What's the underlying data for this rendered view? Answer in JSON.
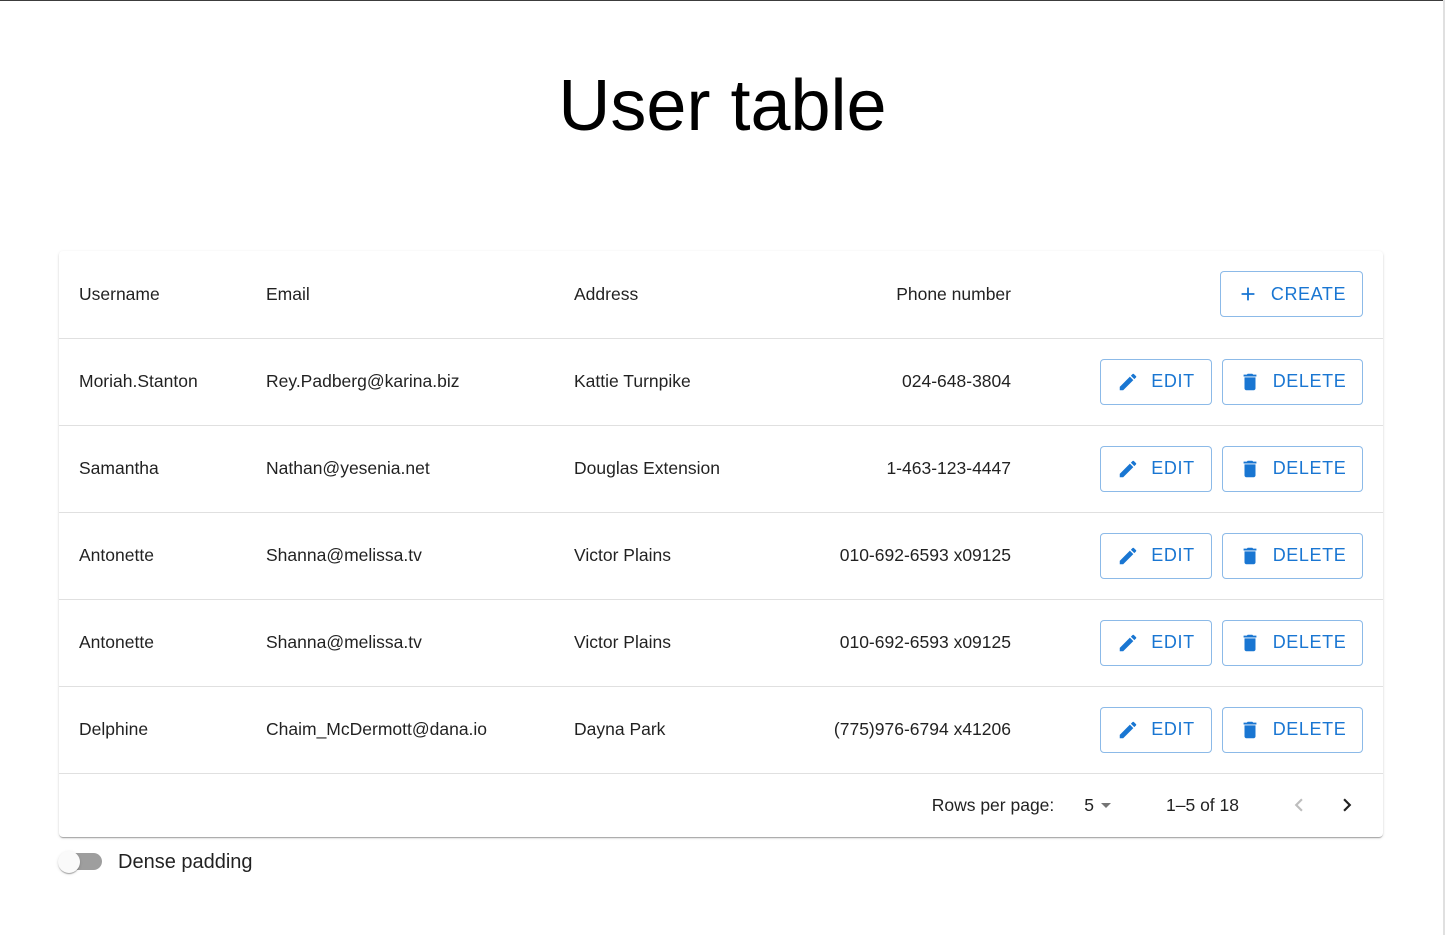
{
  "title": "User table",
  "table": {
    "headers": {
      "username": "Username",
      "email": "Email",
      "address": "Address",
      "phone": "Phone number"
    },
    "create_label": "CREATE",
    "edit_label": "EDIT",
    "delete_label": "DELETE",
    "rows": [
      {
        "username": "Moriah.Stanton",
        "email": "Rey.Padberg@karina.biz",
        "address": "Kattie Turnpike",
        "phone": "024-648-3804"
      },
      {
        "username": "Samantha",
        "email": "Nathan@yesenia.net",
        "address": "Douglas Extension",
        "phone": "1-463-123-4447"
      },
      {
        "username": "Antonette",
        "email": "Shanna@melissa.tv",
        "address": "Victor Plains",
        "phone": "010-692-6593 x09125"
      },
      {
        "username": "Antonette",
        "email": "Shanna@melissa.tv",
        "address": "Victor Plains",
        "phone": "010-692-6593 x09125"
      },
      {
        "username": "Delphine",
        "email": "Chaim_McDermott@dana.io",
        "address": "Dayna Park",
        "phone": "(775)976-6794 x41206"
      }
    ]
  },
  "pagination": {
    "rows_per_page_label": "Rows per page:",
    "rows_per_page_value": "5",
    "range_text": "1–5 of 18"
  },
  "dense_padding": {
    "label": "Dense padding",
    "checked": false
  },
  "colors": {
    "primary": "#1976d2",
    "divider": "#e0e0e0",
    "switch_track": "#9e9e9e"
  }
}
